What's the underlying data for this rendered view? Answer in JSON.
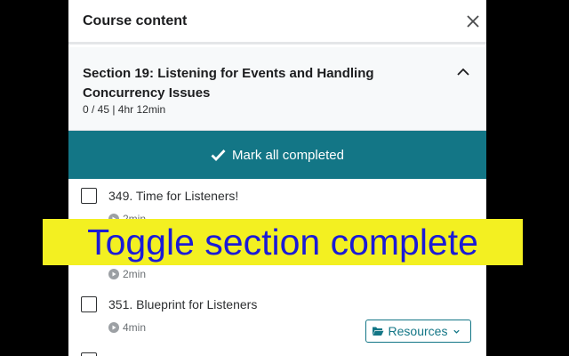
{
  "panel": {
    "title": "Course content",
    "close_icon": "close-icon"
  },
  "section": {
    "title": "Section 19: Listening for Events and Handling Concurrency Issues",
    "meta": "0 / 45 | 4hr 12min",
    "collapse_icon": "chevron-up-icon"
  },
  "mark_all": {
    "label": "Mark all completed",
    "icon": "check-icon"
  },
  "lectures": [
    {
      "title": "349. Time for Listeners!",
      "duration": "2min",
      "checked": false
    },
    {
      "title": "",
      "duration": "2min",
      "checked": false
    },
    {
      "title": "351. Blueprint for Listeners",
      "duration": "4min",
      "checked": false
    }
  ],
  "resources_button": {
    "label": "Resources",
    "icon": "folder-open-icon"
  },
  "overlay": {
    "text": "Toggle section complete"
  },
  "colors": {
    "accent": "#137686",
    "overlay_bg": "#f3f021",
    "overlay_text": "#1b1bd6"
  }
}
